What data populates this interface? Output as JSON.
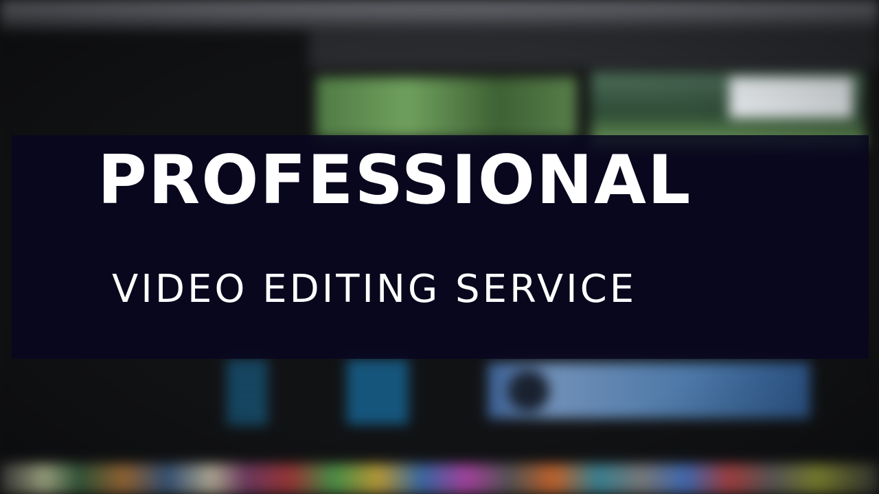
{
  "banner": {
    "title": "PROFESSIONAL",
    "subtitle": "VIDEO EDITING SERVICE"
  },
  "colors": {
    "banner_background": "#08061F",
    "text": "#FFFFFF"
  }
}
